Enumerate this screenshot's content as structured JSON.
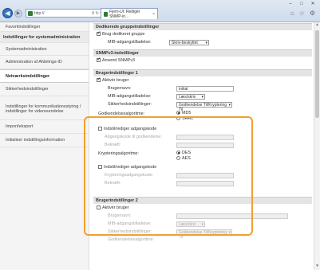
{
  "browser": {
    "address": "http://",
    "tab_title": "Fjern-UI: Redigér SNMP-in...",
    "tab_close": "×",
    "window_controls": [
      "–",
      "□",
      "✕"
    ],
    "nav_back": "◀",
    "nav_forward": "▶",
    "addr_search": "⚲",
    "addr_refresh": "↻",
    "addr_stop": "✕",
    "tool_icons": [
      "⌂",
      "☆",
      "⚙"
    ]
  },
  "sidebar": {
    "items": [
      {
        "label": "Favoritindstillinger",
        "type": "item"
      },
      {
        "label": "Indstillinger for systemadministration",
        "type": "head"
      },
      {
        "label": "Systemadministration",
        "type": "item"
      },
      {
        "label": "Administration af Afdelings-ID",
        "type": "item"
      },
      {
        "label": "Netværksindstillinger",
        "type": "active"
      },
      {
        "label": "Sikkerhedsindstillinger",
        "type": "item"
      },
      {
        "label": "Indstillinger for kommunikationsstyring / indstillinger for videresendelse",
        "type": "item"
      },
      {
        "label": "Import/eksport",
        "type": "item"
      },
      {
        "label": "Initialiser indstillingsinformation",
        "type": "item"
      }
    ]
  },
  "main": {
    "dedikeret": {
      "title": "Dedikerede gruppeindstillinger",
      "use_label": "Brug dedikeret gruppe",
      "mib_label": "MIB-adgangstilladelse:",
      "mib_value": "Skriv-beskyttet"
    },
    "snmpv3": {
      "title": "SNMPv3-indstillinger",
      "use_label": "Anvend SNMPv3"
    },
    "user1": {
      "title": "Brugerindstillinger 1",
      "activate_label": "Aktivér bruger",
      "username_label": "Brugernavn:",
      "username_value": "initial",
      "mib_label": "MIB-adgangstilladelse:",
      "mib_value": "Læs/skriv",
      "security_label": "Sikkerhedsindstillinger:",
      "security_value": "Godkendelse Til/Kryptering Til",
      "auth_algo_label": "Godkendelsesalgoritme:",
      "auth_algo_options": [
        "MD5",
        "SHA1"
      ],
      "auth_pw_checkbox": "Indstil/rediger adgangskode",
      "auth_pw_label": "Adgangskode til godkendelse:",
      "confirm_label": "Bekræft:",
      "enc_algo_label": "Krypteringsalgoritme:",
      "enc_algo_options": [
        "DES",
        "AES"
      ],
      "enc_pw_checkbox": "Indstil/rediger adgangskode",
      "enc_pw_label": "Krypteringsadgangskode:",
      "confirm2_label": "Bekræft:"
    },
    "user2": {
      "title": "Brugerindstillinger 2",
      "activate_label": "Aktivér bruger",
      "username_label": "Brugernavn:",
      "mib_label": "MIB-adgangstilladelse:",
      "mib_value": "Læs/skriv",
      "security_label": "Sikkerhedsindstillinger:",
      "security_value": "Godkendelse Til/Kryptering Til",
      "auth_algo_label": "Godkendelsesalgoritme:"
    }
  },
  "scroll": {
    "up": "▲",
    "down": "▼"
  }
}
